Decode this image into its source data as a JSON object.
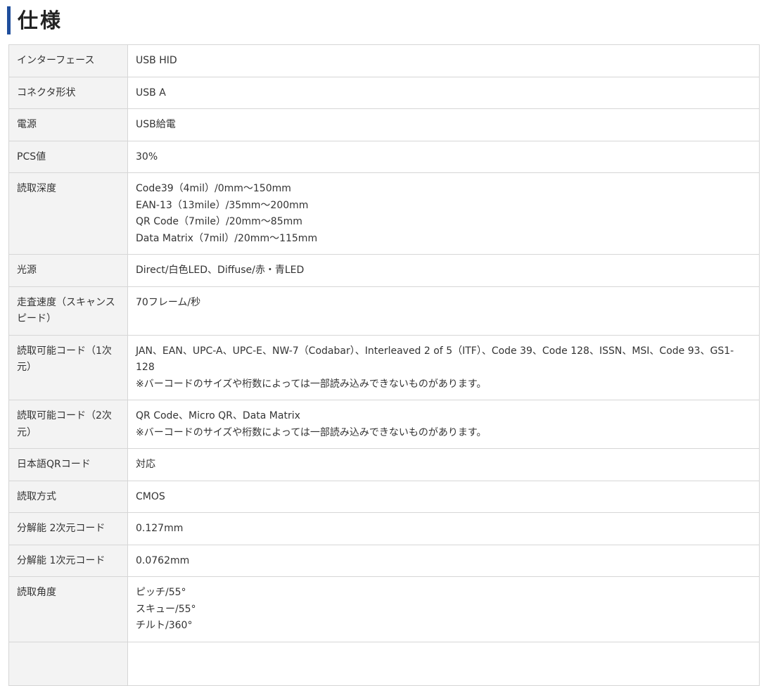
{
  "heading": "仕様",
  "rows": [
    {
      "key": "インターフェース",
      "lines": [
        "USB HID"
      ]
    },
    {
      "key": "コネクタ形状",
      "lines": [
        "USB A"
      ]
    },
    {
      "key": "電源",
      "lines": [
        "USB給電"
      ]
    },
    {
      "key": "PCS値",
      "lines": [
        "30%"
      ]
    },
    {
      "key": "読取深度",
      "lines": [
        "Code39（4mil）/0mm〜150mm",
        "EAN-13（13mile）/35mm〜200mm",
        "QR Code（7mile）/20mm〜85mm",
        "Data Matrix（7mil）/20mm〜115mm"
      ]
    },
    {
      "key": "光源",
      "lines": [
        "Direct/白色LED、Diffuse/赤・青LED"
      ]
    },
    {
      "key": "走査速度（スキャンスピード）",
      "lines": [
        "70フレーム/秒"
      ]
    },
    {
      "key": "読取可能コード（1次元）",
      "lines": [
        "JAN、EAN、UPC-A、UPC-E、NW-7（Codabar）、Interleaved 2 of 5（ITF）、Code 39、Code 128、ISSN、MSI、Code 93、GS1-128",
        "※バーコードのサイズや桁数によっては一部読み込みできないものがあります。"
      ]
    },
    {
      "key": "読取可能コード（2次元）",
      "lines": [
        "QR Code、Micro QR、Data Matrix",
        "※バーコードのサイズや桁数によっては一部読み込みできないものがあります。"
      ]
    },
    {
      "key": "日本語QRコード",
      "lines": [
        "対応"
      ]
    },
    {
      "key": "読取方式",
      "lines": [
        "CMOS"
      ]
    },
    {
      "key": "分解能 2次元コード",
      "lines": [
        "0.127mm"
      ]
    },
    {
      "key": "分解能 1次元コード",
      "lines": [
        "0.0762mm"
      ]
    },
    {
      "key": "読取角度",
      "lines": [
        "ピッチ/55°",
        "スキュー/55°",
        "チルト/360°"
      ]
    },
    {
      "key": "",
      "lines": [
        ""
      ]
    }
  ]
}
